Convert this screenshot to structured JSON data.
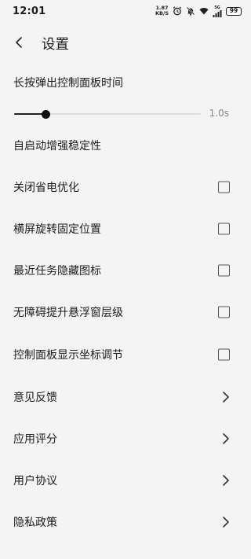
{
  "status_bar": {
    "time": "12:01",
    "net_speed_value": "1.87",
    "net_speed_unit": "KB/S",
    "signal_label": "5G",
    "battery": "99",
    "icons": [
      "alarm-icon",
      "mute-icon",
      "wifi-icon",
      "signal-icon",
      "battery-icon"
    ]
  },
  "header": {
    "back_icon": "back-arrow-icon",
    "title": "设置"
  },
  "long_press": {
    "label": "长按弹出控制面板时间",
    "slider_fraction": 0.17,
    "value_text": "1.0s"
  },
  "auto_start": {
    "label": "自启动增强稳定性"
  },
  "toggles": [
    {
      "label": "关闭省电优化",
      "checked": false
    },
    {
      "label": "横屏旋转固定位置",
      "checked": false
    },
    {
      "label": "最近任务隐藏图标",
      "checked": false
    },
    {
      "label": "无障碍提升悬浮窗层级",
      "checked": false
    },
    {
      "label": "控制面板显示坐标调节",
      "checked": false
    }
  ],
  "links": [
    {
      "label": "意见反馈",
      "icon": "chevron-right-icon"
    },
    {
      "label": "应用评分",
      "icon": "chevron-right-icon"
    },
    {
      "label": "用户协议",
      "icon": "chevron-right-icon"
    },
    {
      "label": "隐私政策",
      "icon": "chevron-right-icon"
    }
  ]
}
